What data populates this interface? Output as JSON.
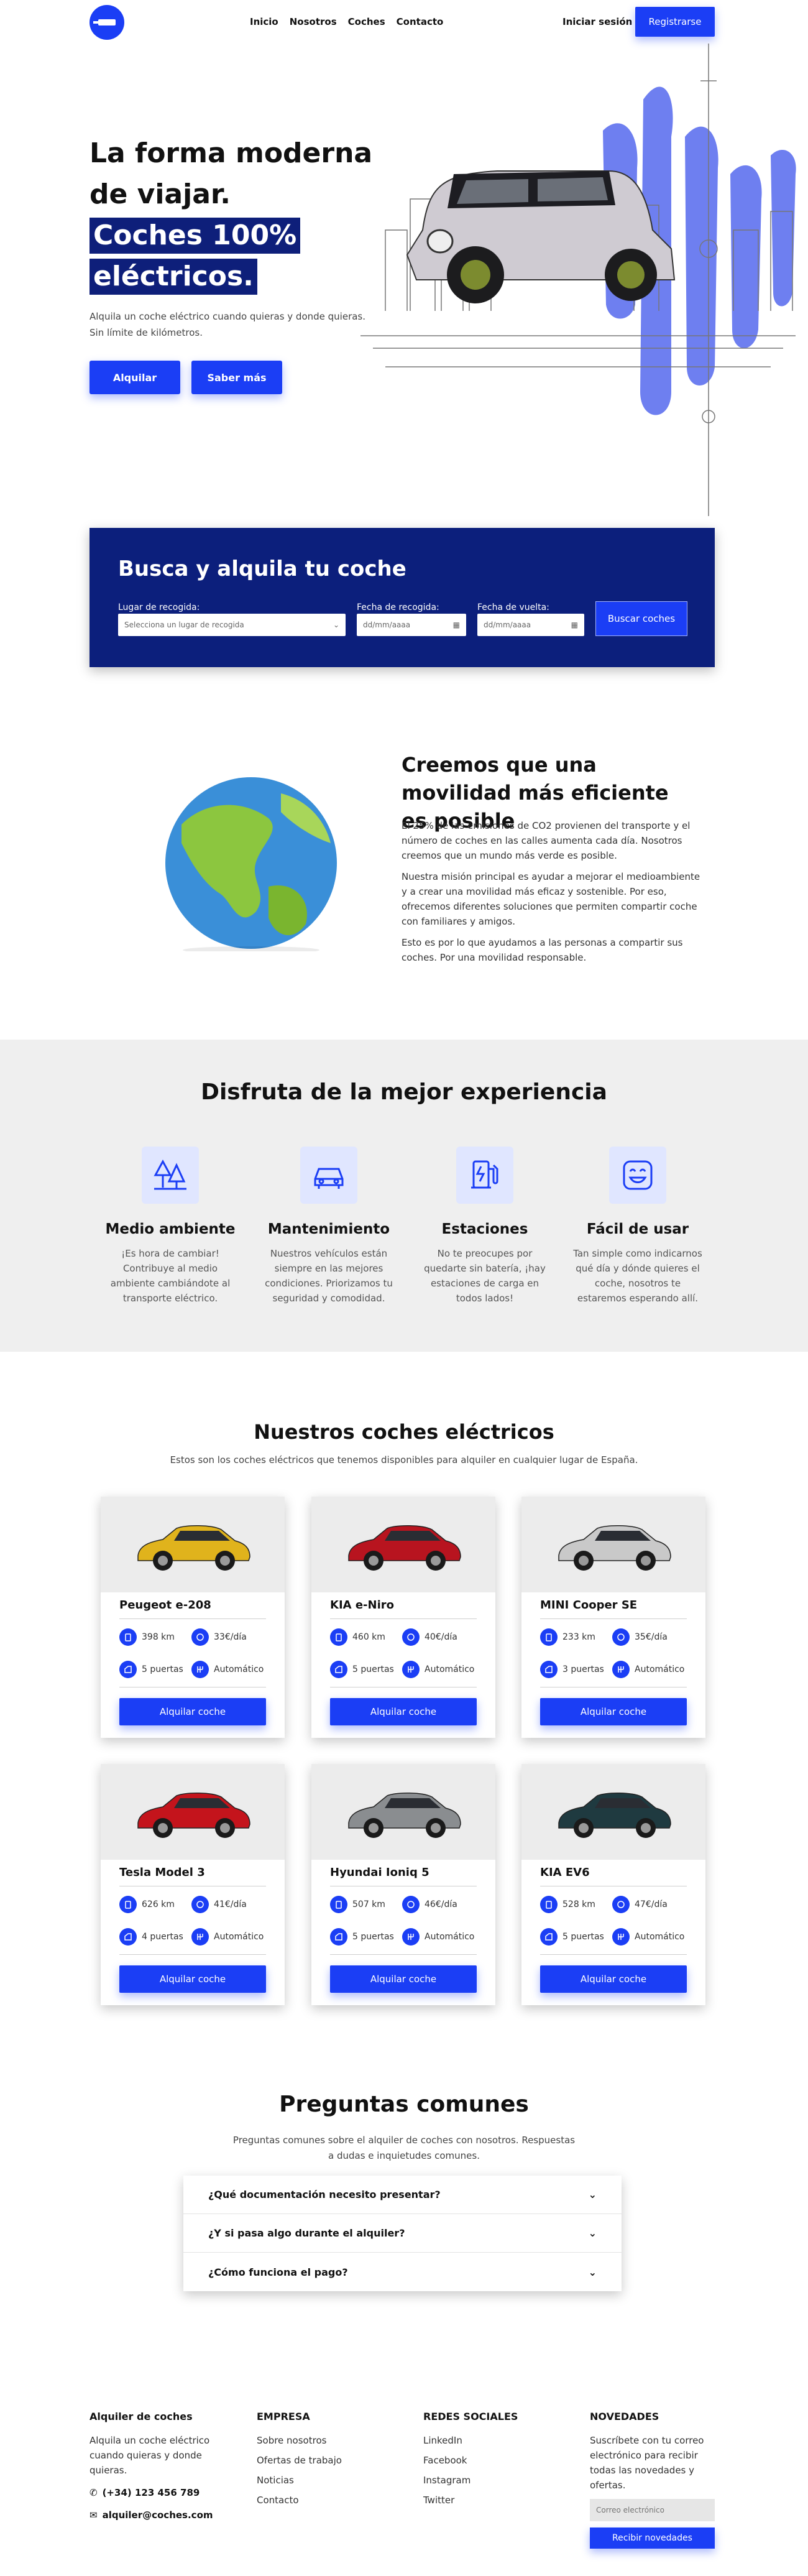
{
  "nav": {
    "links": [
      "Inicio",
      "Nosotros",
      "Coches",
      "Contacto"
    ],
    "login": "Iniciar sesión",
    "register": "Registrarse"
  },
  "hero": {
    "line1": "La forma moderna",
    "line2": "de viajar.",
    "hl1": "Coches 100%",
    "hl2": "eléctricos.",
    "subtitle": "Alquila un coche eléctrico cuando quieras y donde quieras. Sin límite de kilómetros.",
    "btn_rent": "Alquilar",
    "btn_more": "Saber más"
  },
  "search": {
    "title": "Busca y alquila tu coche",
    "pickup_label": "Lugar de recogida:",
    "pickup_placeholder": "Selecciona un lugar de recogida",
    "pickup_date_label": "Fecha de recogida:",
    "return_date_label": "Fecha de vuelta:",
    "date_placeholder": "dd/mm/aaaa",
    "button": "Buscar coches"
  },
  "mission": {
    "title": "Creemos que una movilidad más eficiente es posible",
    "p1": "El 25% de las emisiones de CO2 provienen del transporte y el número de coches en las calles aumenta cada día. Nosotros creemos que un mundo más verde es posible.",
    "p2": "Nuestra misión principal es ayudar a mejorar el medioambiente y a crear una movilidad más eficaz y sostenible. Por eso, ofrecemos diferentes soluciones que permiten compartir coche con familiares y amigos.",
    "p3": "Esto es por lo que ayudamos a las personas a compartir sus coches. Por una movilidad responsable."
  },
  "experience": {
    "title": "Disfruta de la mejor experiencia",
    "features": [
      {
        "title": "Medio ambiente",
        "text": "¡Es hora de cambiar! Contribuye al medio ambiente cambiándote al transporte eléctrico.",
        "icon": "trees-icon"
      },
      {
        "title": "Mantenimiento",
        "text": "Nuestros vehículos están siempre en las mejores condiciones. Priorizamos tu seguridad y comodidad.",
        "icon": "car-icon"
      },
      {
        "title": "Estaciones",
        "text": "No te preocupes por quedarte sin batería, ¡hay estaciones de carga en todos lados!",
        "icon": "charging-station-icon"
      },
      {
        "title": "Fácil de usar",
        "text": "Tan simple como indicarnos qué día y dónde quieres el coche, nosotros te estaremos esperando allí.",
        "icon": "smile-icon"
      }
    ]
  },
  "cars": {
    "title": "Nuestros coches eléctricos",
    "subtitle": "Estos son los coches eléctricos que tenemos disponibles para alquiler en cualquier lugar de España.",
    "cta": "Alquilar coche",
    "items": [
      {
        "name": "Peugeot e-208",
        "range": "398 km",
        "price": "33€/día",
        "doors": "5 puertas",
        "gear": "Automático",
        "color": "#e0b31c"
      },
      {
        "name": "KIA e-Niro",
        "range": "460 km",
        "price": "40€/día",
        "doors": "5 puertas",
        "gear": "Automático",
        "color": "#b8141f"
      },
      {
        "name": "MINI Cooper SE",
        "range": "233 km",
        "price": "35€/día",
        "doors": "3 puertas",
        "gear": "Automático",
        "color": "#c9c9c9"
      },
      {
        "name": "Tesla Model 3",
        "range": "626 km",
        "price": "41€/día",
        "doors": "4 puertas",
        "gear": "Automático",
        "color": "#c4141c"
      },
      {
        "name": "Hyundai Ioniq 5",
        "range": "507 km",
        "price": "46€/día",
        "doors": "5 puertas",
        "gear": "Automático",
        "color": "#8a8d90"
      },
      {
        "name": "KIA EV6",
        "range": "528 km",
        "price": "47€/día",
        "doors": "5 puertas",
        "gear": "Automático",
        "color": "#1f3a40"
      }
    ]
  },
  "faq": {
    "title": "Preguntas comunes",
    "subtitle": "Preguntas comunes sobre el alquiler de coches con nosotros. Respuestas a dudas e inquietudes comunes.",
    "questions": [
      "¿Qué documentación necesito presentar?",
      "¿Y si pasa algo durante el alquiler?",
      "¿Cómo funciona el pago?"
    ]
  },
  "footer": {
    "brand": "Alquiler de coches",
    "brand_text": "Alquila un coche eléctrico cuando quieras y donde quieras.",
    "phone": "(+34) 123 456 789",
    "email": "alquiler@coches.com",
    "company_title": "EMPRESA",
    "company_links": [
      "Sobre nosotros",
      "Ofertas de trabajo",
      "Noticias",
      "Contacto"
    ],
    "social_title": "REDES SOCIALES",
    "social_links": [
      "LinkedIn",
      "Facebook",
      "Instagram",
      "Twitter"
    ],
    "news_title": "NOVEDADES",
    "news_text": "Suscríbete con tu correo electrónico para recibir todas las novedades y ofertas.",
    "news_placeholder": "Correo electrónico",
    "news_button": "Recibir novedades"
  },
  "colors": {
    "accent": "#1b3ef5",
    "navy": "#0c1f7c"
  }
}
